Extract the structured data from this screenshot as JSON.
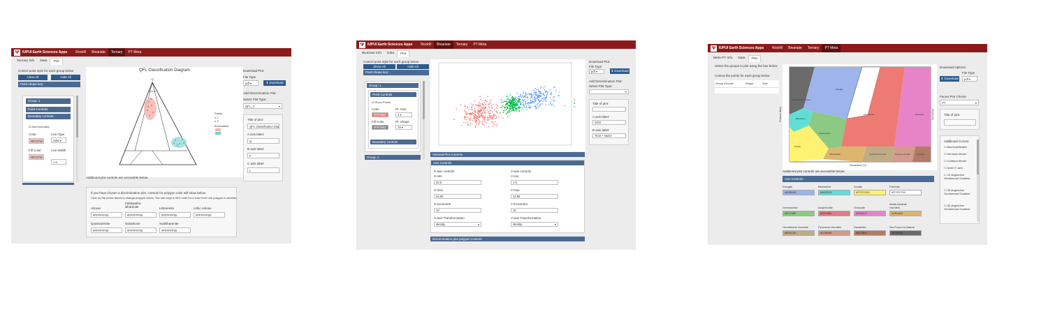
{
  "common": {
    "app_title": "IUPUI Earth Sciences Apps",
    "logo_glyph": "Ψ",
    "nav": [
      "RockR",
      "Bivariate",
      "Ternary",
      "PT Meta"
    ],
    "download_label": "Download"
  },
  "s1": {
    "tabs": [
      "Ternary Info",
      "Data",
      "Plot"
    ],
    "control_title": "Control point style for each group below",
    "clear_all": "Clear All",
    "hide_all": "Hide All",
    "point_shape_key": "Point shape key:",
    "group_header": "Group: 1",
    "point_controls": "Point Controls",
    "boundary_controls": "Boundary controls:",
    "add_boundary": "Add boundary:",
    "color_label": "Color:",
    "color_value": "#B73734",
    "line_type_label": "Line Type",
    "line_type_value": "solid",
    "fill_color_label": "Fill Color:",
    "fill_color_value": "#B73734",
    "line_width_label": "Line Width",
    "line_width_value": "1",
    "chart_title": "QFL Classification Diagram",
    "top_vertex": "Q",
    "legend_title_points": "Points",
    "legend_title_boundaries": "Boundaries",
    "legend_items": [
      "1",
      "2"
    ],
    "download_plot": "Download Plot:",
    "file_type_label": "File Type",
    "file_type_value": "pdf",
    "add_discrimination": "Add Discrimination Plot:",
    "select_plot_type": "Select Plot Type:",
    "plot_type_value": "QFL_2",
    "title_of_plot": "Title of plot:",
    "title_value": "QFL Classification Diag",
    "a_axis_label": "A axis label:",
    "a_axis_value": "Q",
    "b_axis_label": "B axis label:",
    "b_axis_value": "F",
    "c_axis_label": "C axis label:",
    "c_axis_value": "L",
    "additional": "Additional plot controls are accessible below:",
    "discrim_info": "If you have chosen a discrimination plot, controls for polygon color will show below:",
    "discrim_hint": "Click on the boxes below to change polygon colors. You can copy a HEX code for a color from one polygon to another.",
    "swatches": [
      {
        "label": "Arkose",
        "value": "#FFFFFF00"
      },
      {
        "label": "Feldspathic litharenite",
        "value": "#FFFFFF00"
      },
      {
        "label": "Litharenite",
        "value": "#FFFFFF00"
      },
      {
        "label": "Lithic Arkose",
        "value": "#FFFFFF00"
      },
      {
        "label": "Quartzarenite",
        "value": "#FFFFFF00"
      },
      {
        "label": "Subarkose",
        "value": "#FFFFFF00"
      },
      {
        "label": "Sublitharenite",
        "value": "#FFFFFF00"
      }
    ]
  },
  "s2": {
    "tabs": [
      "Bivariate Info",
      "Data",
      "Plot"
    ],
    "control_title": "Control point style for each group below",
    "show_all": "Show All",
    "hide_all": "Hide All",
    "point_shape_key": "Point shape key:",
    "group1": "Group: 1",
    "point_controls": "Point Controls",
    "show_points": "Show Points",
    "color_label": "Color",
    "color_value": "#F8766D",
    "pt_size_label": "Pt. Size",
    "pt_size_value": "4",
    "fill_color_label": "Fill Color",
    "fill_color_value": "#F8766D",
    "pt_shape_label": "Pt. Shape",
    "pt_shape_value": "19",
    "boundary_controls": "Boundary controls",
    "group2": "Group: 2",
    "download_plot": "Download Plot:",
    "file_type_label": "File Type",
    "file_type_value": "pdf",
    "add_discrimination": "Add Discrimination Plot:",
    "select_plot_type": "Select Plot Type:",
    "title_of_plot": "Title of plot:",
    "a_axis_label": "A axis label:",
    "a_axis_value": "SiO2",
    "b_axis_label": "B axis label:",
    "b_axis_value": "TiO2 + Na2O",
    "general_controls": "General Plot Controls",
    "axis_controls": "Axis Controls",
    "x_axis_controls": "X-axis controls",
    "y_axis_controls": "Y-axis controls",
    "xmin_label": "X-min",
    "xmin_value": "42.5",
    "ymin_label": "Y-min",
    "ymin_value": "1.5",
    "xmax_label": "X-max",
    "xmax_value": "54.85",
    "ymax_label": "Y-max",
    "ymax_value": "13.85",
    "xinc_label": "X-increment",
    "xinc_value": "10",
    "yinc_label": "Y-increment",
    "yinc_value": "10",
    "xtrans_label": "X-axis Transformation",
    "xtrans_value": "identity",
    "ytrans_label": "Y-axis Transformation",
    "ytrans_value": "identity",
    "discrim_controls": "Discrimination plot polygon controls"
  },
  "s3": {
    "tabs": [
      "Meta PT Info",
      "Data",
      "Plot"
    ],
    "select_groups": "Select the groups to plot using the box below",
    "control_points": "Control the points for each group below",
    "table_headers": [
      "Group ID/color",
      "Shape",
      "Size"
    ],
    "download_options": "Download Options:",
    "file_type_label": "File Type",
    "file_type_value": "pdf",
    "facies_choice": "Facies Plot Choice:",
    "facies_value": "PT",
    "title_of_plot": "Title of plot:",
    "additional_curves": "Additional Curves:",
    "curves": [
      "Aluminosilicates",
      "Intrusion Model",
      "Collision Model",
      "Invert Y axis",
      "10 degree/km Geothermal Gradient",
      "20 degree/km Geothermal Gradient",
      "30 degree/km Geothermal Gradient"
    ],
    "y_axis_title": "Pressure (kbar)",
    "x_axis_title": "Temperature [°C]",
    "depth_title": "Depth (km)",
    "facies_labels": {
      "eclogite": "Eclogite",
      "blueschist": "Blueschist",
      "greenschist": "Greenschist",
      "amphibolite": "Amphibolite",
      "granulite": "Granulite",
      "zeolite": "Zeolite",
      "prehnite": "Prehnite",
      "hornblende": "Hornblende Hornfels",
      "pyroxene": "Pyroxene Hornfels",
      "sanidinite": "Sanidinite",
      "not_found": "Not Found in Nature",
      "albite": "Albite Epidote"
    },
    "additional": "Additional plot controls are accessible below:",
    "axis_controls": "Axis Controls",
    "swatches": [
      {
        "label": "Eclogite",
        "value": "#9DB5EB",
        "color": "#9db5eb"
      },
      {
        "label": "Blueschist",
        "value": "#60DED5",
        "color": "#60ded5"
      },
      {
        "label": "Zeolite",
        "value": "#FFF27000",
        "color": "#fff270"
      },
      {
        "label": "Prehnite",
        "value": "#FFFFFF00",
        "color": "#ffffff"
      },
      {
        "label": "Greenschist",
        "value": "#8CC982",
        "color": "#8cc982"
      },
      {
        "label": "Amphibolite",
        "value": "#E07A8A",
        "color": "#e07a8a"
      },
      {
        "label": "Granulite",
        "value": "#E684C7",
        "color": "#e684c7"
      },
      {
        "label": "Albite-Epidote Hornfels",
        "value": "#CBA663",
        "color": "#dcb670"
      },
      {
        "label": "Hornblende Hornfels",
        "value": "#BFAC85",
        "color": "#bfac85"
      },
      {
        "label": "Pyroxene Hornfels",
        "value": "#D29B8B",
        "color": "#d29b8b"
      },
      {
        "label": "Sanidinite",
        "value": "#B27B66",
        "color": "#b27b66"
      },
      {
        "label": "Not Found in Nature",
        "value": "#6B6B6B",
        "color": "#6b6b6b"
      }
    ]
  },
  "colors": {
    "header": "#8C1A1A",
    "accent": "#2D5A8C",
    "group_bar": "#4B6A93"
  }
}
